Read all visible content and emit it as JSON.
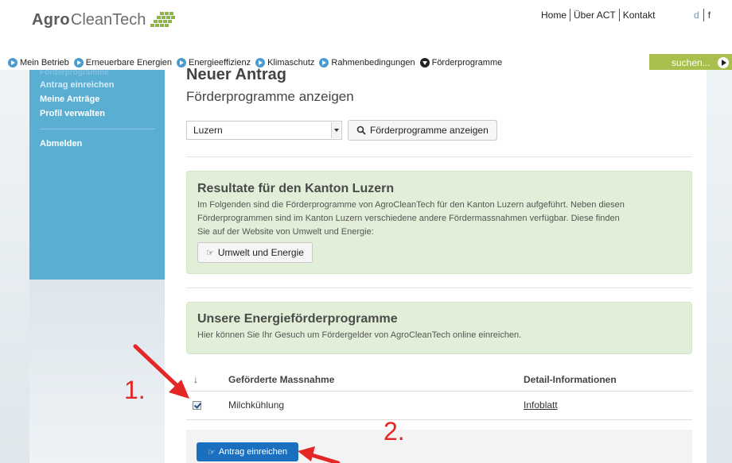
{
  "header": {
    "logo": {
      "part1": "Agro",
      "part2": "CleanTech"
    },
    "topnav": [
      "Home",
      "Über ACT",
      "Kontakt"
    ],
    "languages": [
      "d",
      "f"
    ]
  },
  "mainnav": {
    "items": [
      "Mein Betrieb",
      "Erneuerbare Energien",
      "Energieeffizienz",
      "Klimaschutz",
      "Rahmenbedingungen",
      "Förderprogramme"
    ],
    "search_placeholder": "suchen..."
  },
  "sidebar": {
    "links": [
      "Antrag einreichen",
      "Meine Anträge",
      "Profil verwalten",
      "Abmelden"
    ]
  },
  "main": {
    "title": "Neuer Antrag",
    "subtitle": "Förderprogramme anzeigen",
    "select_value": "Luzern",
    "show_button": "Förderprogramme anzeigen",
    "results_panel": {
      "heading": "Resultate für den Kanton Luzern",
      "text_lines": [
        "Im Folgenden sind die Förderprogramme von AgroCleanTech für den Kanton Luzern aufgeführt. Neben diesen",
        "Förderprogrammen sind im Kanton Luzern verschiedene andere Fördermassnahmen verfügbar. Diese finden",
        "Sie auf der Website von Umwelt und Energie:"
      ],
      "button": "Umwelt und Energie"
    },
    "programs_panel": {
      "heading": "Unsere Energieförderprogramme",
      "text": "Hier können Sie Ihr Gesuch um Fördergelder von AgroCleanTech online einreichen."
    },
    "table": {
      "columns": [
        "↓",
        "Geförderte Massnahme",
        "Detail-Informationen"
      ],
      "rows": [
        {
          "checked": true,
          "measure": "Milchkühlung",
          "info": "Infoblatt"
        }
      ]
    },
    "submit_button": "Antrag einreichen"
  },
  "annotations": {
    "step1": "1.",
    "step2": "2.",
    "color": "#e32626"
  },
  "colors": {
    "sidebar": "#5aaed2",
    "panel": "#e1efd8",
    "primary": "#1a6fbe",
    "search": "#a8bf4e"
  }
}
